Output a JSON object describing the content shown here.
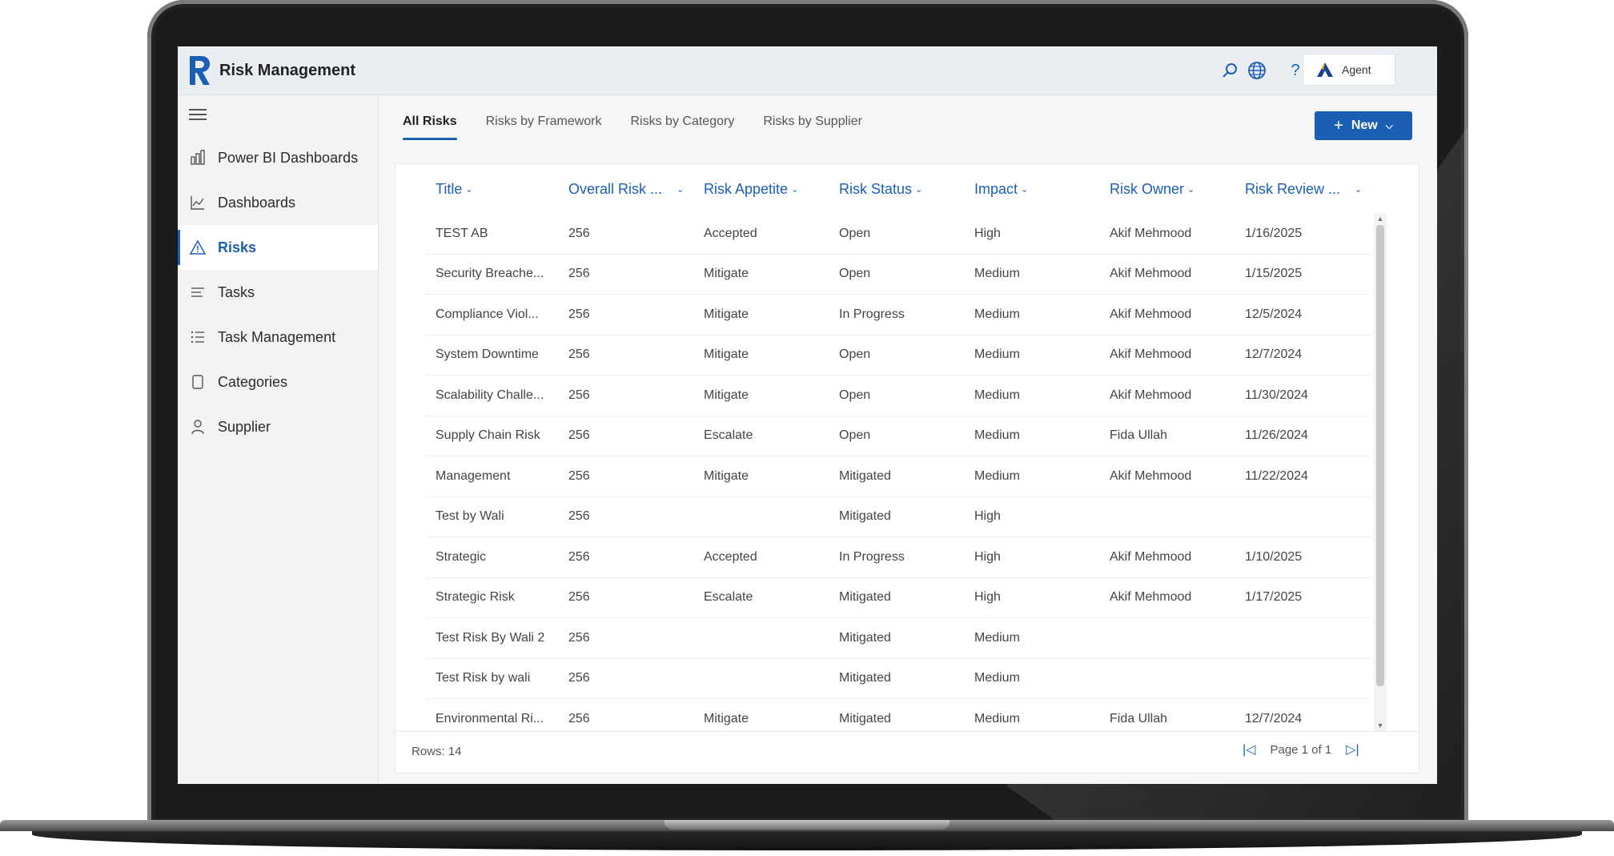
{
  "app": {
    "title": "Risk Management",
    "logo_letter": "R"
  },
  "header": {
    "agent_label": "Agent",
    "icons": [
      "search-icon",
      "globe-icon",
      "help-icon"
    ]
  },
  "sidebar": {
    "items": [
      {
        "label": "Power BI Dashboards",
        "icon": "report-icon"
      },
      {
        "label": "Dashboards",
        "icon": "chart-icon"
      },
      {
        "label": "Risks",
        "icon": "warning-icon",
        "active": true
      },
      {
        "label": "Tasks",
        "icon": "lines-icon"
      },
      {
        "label": "Task Management",
        "icon": "checklist-icon"
      },
      {
        "label": "Categories",
        "icon": "page-icon"
      },
      {
        "label": "Supplier",
        "icon": "person-icon"
      }
    ]
  },
  "tabs": [
    {
      "label": "All Risks",
      "active": true
    },
    {
      "label": "Risks by Framework"
    },
    {
      "label": "Risks by Category"
    },
    {
      "label": "Risks by Supplier"
    }
  ],
  "toolbar": {
    "new_label": "New"
  },
  "table": {
    "columns": [
      "Title",
      "Overall Risk ...",
      "Risk Appetite",
      "Risk Status",
      "Impact",
      "Risk Owner",
      "Risk Review ..."
    ],
    "rows": [
      [
        "TEST AB",
        "256",
        "Accepted",
        "Open",
        "High",
        "Akif Mehmood",
        "1/16/2025"
      ],
      [
        "Security Breache...",
        "256",
        "Mitigate",
        "Open",
        "Medium",
        "Akif Mehmood",
        "1/15/2025"
      ],
      [
        "Compliance Viol...",
        "256",
        "Mitigate",
        "In Progress",
        "Medium",
        "Akif Mehmood",
        "12/5/2024"
      ],
      [
        "System Downtime",
        "256",
        "Mitigate",
        "Open",
        "Medium",
        "Akif Mehmood",
        "12/7/2024"
      ],
      [
        "Scalability Challe...",
        "256",
        "Mitigate",
        "Open",
        "Medium",
        "Akif Mehmood",
        "11/30/2024"
      ],
      [
        "Supply Chain Risk",
        "256",
        "Escalate",
        "Open",
        "Medium",
        "Fida Ullah",
        "11/26/2024"
      ],
      [
        "Management",
        "256",
        "Mitigate",
        "Mitigated",
        "Medium",
        "Akif Mehmood",
        "11/22/2024"
      ],
      [
        "Test by Wali",
        "256",
        "",
        "Mitigated",
        "High",
        "",
        ""
      ],
      [
        "Strategic",
        "256",
        "Accepted",
        "In Progress",
        "High",
        "Akif Mehmood",
        "1/10/2025"
      ],
      [
        "Strategic Risk",
        "256",
        "Escalate",
        "Mitigated",
        "High",
        "Akif Mehmood",
        "1/17/2025"
      ],
      [
        "Test Risk By Wali 2",
        "256",
        "",
        "Mitigated",
        "Medium",
        "",
        ""
      ],
      [
        "Test Risk by wali",
        "256",
        "",
        "Mitigated",
        "Medium",
        "",
        ""
      ],
      [
        "Environmental Ri...",
        "256",
        "Mitigate",
        "Mitigated",
        "Medium",
        "Fida Ullah",
        "12/7/2024"
      ]
    ]
  },
  "footer": {
    "rows_label": "Rows: 14",
    "page_label": "Page 1 of 1"
  },
  "colors": {
    "accent": "#1b5fb5",
    "sidebar_bg": "#f2f3f5",
    "header_bg": "#eaedf2"
  }
}
